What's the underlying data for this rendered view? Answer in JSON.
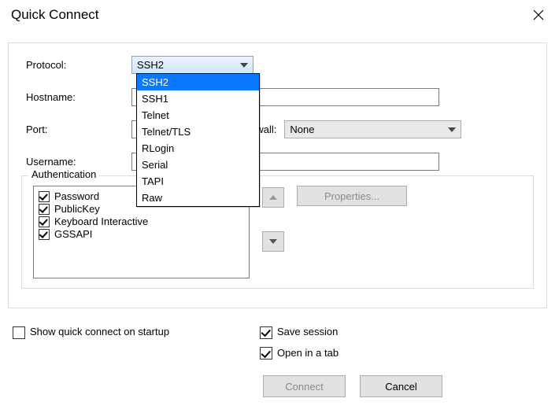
{
  "window": {
    "title": "Quick Connect"
  },
  "labels": {
    "protocol": "Protocol:",
    "hostname": "Hostname:",
    "port": "Port:",
    "firewall": "Firewall:",
    "username": "Username:",
    "authentication": "Authentication",
    "showStartup": "Show quick connect on startup",
    "saveSession": "Save session",
    "openTab": "Open in a tab"
  },
  "protocol": {
    "selected": "SSH2",
    "options": [
      "SSH2",
      "SSH1",
      "Telnet",
      "Telnet/TLS",
      "RLogin",
      "Serial",
      "TAPI",
      "Raw"
    ]
  },
  "hostname": "",
  "port": "",
  "firewall": {
    "selected": "None"
  },
  "username": "",
  "auth": {
    "items": [
      {
        "label": "Password",
        "checked": true
      },
      {
        "label": "PublicKey",
        "checked": true
      },
      {
        "label": "Keyboard Interactive",
        "checked": true
      },
      {
        "label": "GSSAPI",
        "checked": true
      }
    ],
    "propertiesLabel": "Properties..."
  },
  "checks": {
    "showStartup": false,
    "saveSession": true,
    "openTab": true
  },
  "buttons": {
    "connect": "Connect",
    "cancel": "Cancel"
  }
}
